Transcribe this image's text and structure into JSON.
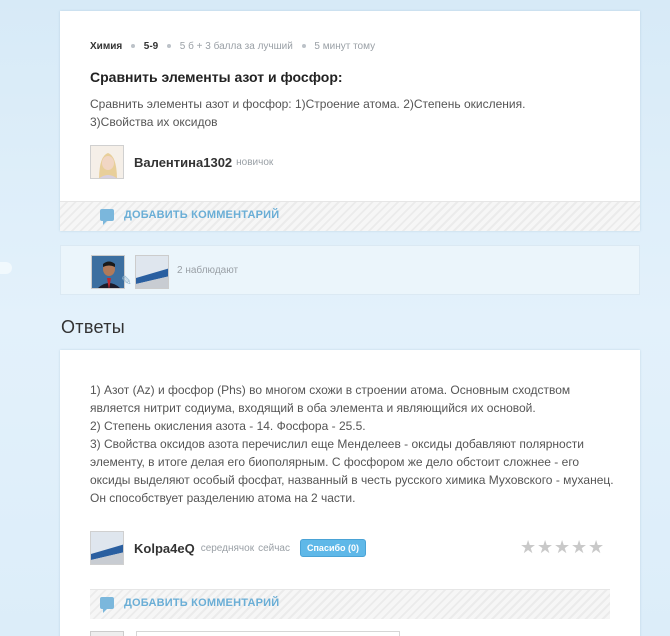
{
  "question": {
    "subject": "Химия",
    "grade": "5-9",
    "points": "5 б + 3 балла за лучший",
    "time": "5 минут тому",
    "title": "Сравнить элементы азот и фосфор:",
    "body": "Сравнить элементы азот и фосфор: 1)Строение атома. 2)Степень окисления. 3)Свойства их оксидов",
    "author": "Валентина1302",
    "author_rank": "новичок",
    "add_comment": "ДОБАВИТЬ КОММЕНТАРИЙ"
  },
  "watchers": {
    "count_text": "2 наблюдают"
  },
  "answers": {
    "heading": "Ответы",
    "items": [
      {
        "lines": [
          "1) Азот (Az) и фосфор (Phs) во многом схожи в строении атома. Основным сходством является нитрит содиума, входящий в оба элемента и являющийся их основой.",
          "2) Степень окисления азота - 14. Фосфора - 25.5.",
          "3) Свойства оксидов азота перечислил еще Менделеев - оксиды добавляют полярности элементу, в итоге делая его биополярным. С фосфором же дело обстоит сложнее - его оксиды выделяют особый фосфат, названный в честь русского химика Муховского - муханец. Он способствует разделению атома на 2 части."
        ],
        "author": "Kolpa4eQ",
        "author_rank": "середнячок",
        "time": "сейчас",
        "thanks_label": "Спасибо (0)",
        "rating": 0,
        "add_comment": "ДОБАВИТЬ КОММЕНТАРИЙ"
      }
    ]
  },
  "colors": {
    "accent": "#6aaed6",
    "thanks_bg": "#5fb8e8",
    "star_empty": "#c9c9c9"
  },
  "icons": [
    "comment-bubble-icon",
    "pencil-icon",
    "star-icon"
  ]
}
